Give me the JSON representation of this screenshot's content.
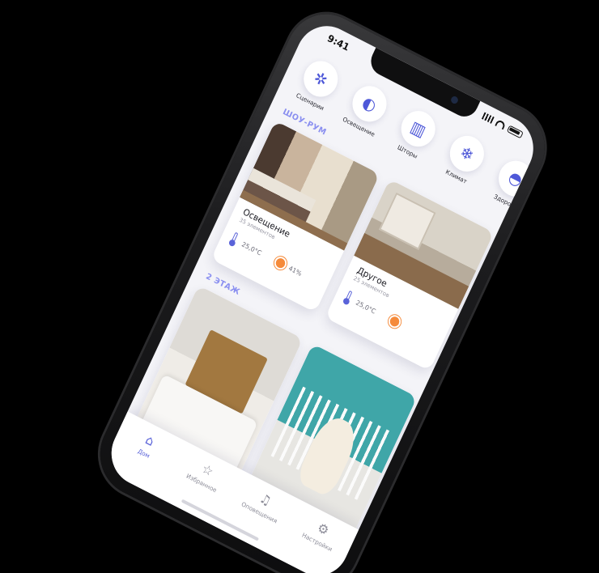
{
  "status_bar": {
    "time": "9:41"
  },
  "categories": [
    {
      "label": "Сценарии",
      "icon": "gear-cluster-icon",
      "glyph": "✲"
    },
    {
      "label": "Освещение",
      "icon": "lightbulb-icon",
      "glyph": "◐"
    },
    {
      "label": "Шторы",
      "icon": "curtains-icon",
      "glyph": "▥"
    },
    {
      "label": "Климат",
      "icon": "snowflake-icon",
      "glyph": "❄"
    },
    {
      "label": "Здоро...",
      "icon": "shield-icon",
      "glyph": "◓"
    }
  ],
  "sections": [
    {
      "title": "ШОУ-РУМ",
      "rooms": [
        {
          "name": "Освещение",
          "subtitle": "35 элементов",
          "temperature": "25,0°C",
          "humidity": "41%",
          "image": "bedroom"
        },
        {
          "name": "Другое",
          "subtitle": "25 элементов",
          "temperature": "25,0°C",
          "humidity": "",
          "image": "kitchen"
        }
      ]
    },
    {
      "title": "2 ЭТАЖ",
      "rooms": [
        {
          "name": "",
          "subtitle": "",
          "temperature": "",
          "humidity": "",
          "image": "bedroom-2"
        },
        {
          "name": "",
          "subtitle": "",
          "temperature": "",
          "humidity": "",
          "image": "nursery"
        }
      ]
    }
  ],
  "tabbar": [
    {
      "label": "Дом",
      "icon": "home-icon",
      "glyph": "⌂",
      "active": true
    },
    {
      "label": "Избранное",
      "icon": "star-icon",
      "glyph": "☆",
      "active": false
    },
    {
      "label": "Оповещения",
      "icon": "bell-icon",
      "glyph": "♫",
      "active": false
    },
    {
      "label": "Настройки",
      "icon": "settings-icon",
      "glyph": "⚙",
      "active": false
    }
  ],
  "colors": {
    "accent": "#5a63d9",
    "section_title": "#8a8ff0",
    "sun": "#f58a3a"
  }
}
